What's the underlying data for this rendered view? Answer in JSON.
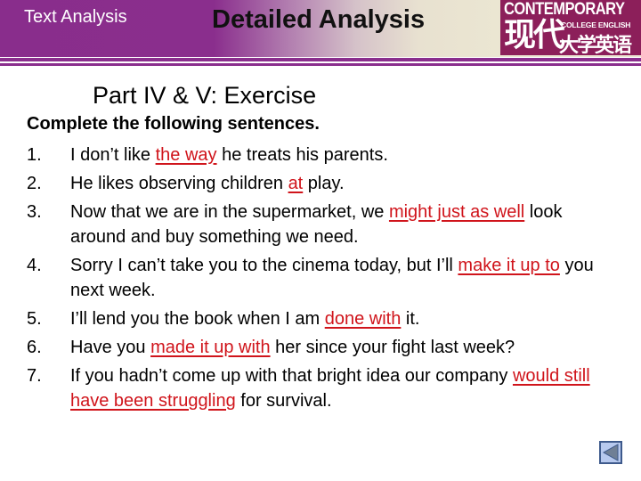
{
  "header": {
    "section_label": "Text Analysis",
    "title": "Detailed Analysis",
    "logo": {
      "english": "CONTEMPORARY",
      "chinese_big": "现代",
      "subtitle": "COLLEGE ENGLISH",
      "chinese_small": "大学英语"
    }
  },
  "subtitle": "Part IV & V:  Exercise",
  "instruction": "Complete the following sentences.",
  "exercises": [
    {
      "number": "1.",
      "parts": [
        {
          "text": "I don’t like ",
          "answer": false
        },
        {
          "text": "the way",
          "answer": true
        },
        {
          "text": " he treats his parents.",
          "answer": false
        }
      ]
    },
    {
      "number": "2.",
      "parts": [
        {
          "text": "He likes observing children ",
          "answer": false
        },
        {
          "text": "at",
          "answer": true
        },
        {
          "text": " play.",
          "answer": false
        }
      ]
    },
    {
      "number": "3.",
      "parts": [
        {
          "text": "Now that we are in the supermarket, we ",
          "answer": false
        },
        {
          "text": "might just as well",
          "answer": true
        },
        {
          "text": " look around and buy something we need.",
          "answer": false
        }
      ]
    },
    {
      "number": "4.",
      "parts": [
        {
          "text": "Sorry I can’t take you to the cinema today, but I’ll ",
          "answer": false
        },
        {
          "text": "make it up to",
          "answer": true
        },
        {
          "text": " you next week.",
          "answer": false
        }
      ]
    },
    {
      "number": "5.",
      "parts": [
        {
          "text": "I’ll lend you the book when I am ",
          "answer": false
        },
        {
          "text": "done with",
          "answer": true
        },
        {
          "text": " it.",
          "answer": false
        }
      ]
    },
    {
      "number": "6.",
      "parts": [
        {
          "text": "Have you ",
          "answer": false
        },
        {
          "text": "made it up with",
          "answer": true
        },
        {
          "text": " her since your  fight last week?",
          "answer": false
        }
      ]
    },
    {
      "number": "7.",
      "parts": [
        {
          "text": "If you hadn’t come up with that bright idea our company ",
          "answer": false
        },
        {
          "text": "would still have been struggling",
          "answer": true
        },
        {
          "text": " for survival.",
          "answer": false
        }
      ]
    }
  ],
  "nav": {
    "back_icon": "triangle-left-icon"
  },
  "colors": {
    "brand_purple": "#8a2e8d",
    "logo_magenta": "#8c1f5a",
    "answer_red": "#d0141b",
    "nav_fill": "#b7c9ee",
    "nav_border": "#3e5a8c"
  }
}
